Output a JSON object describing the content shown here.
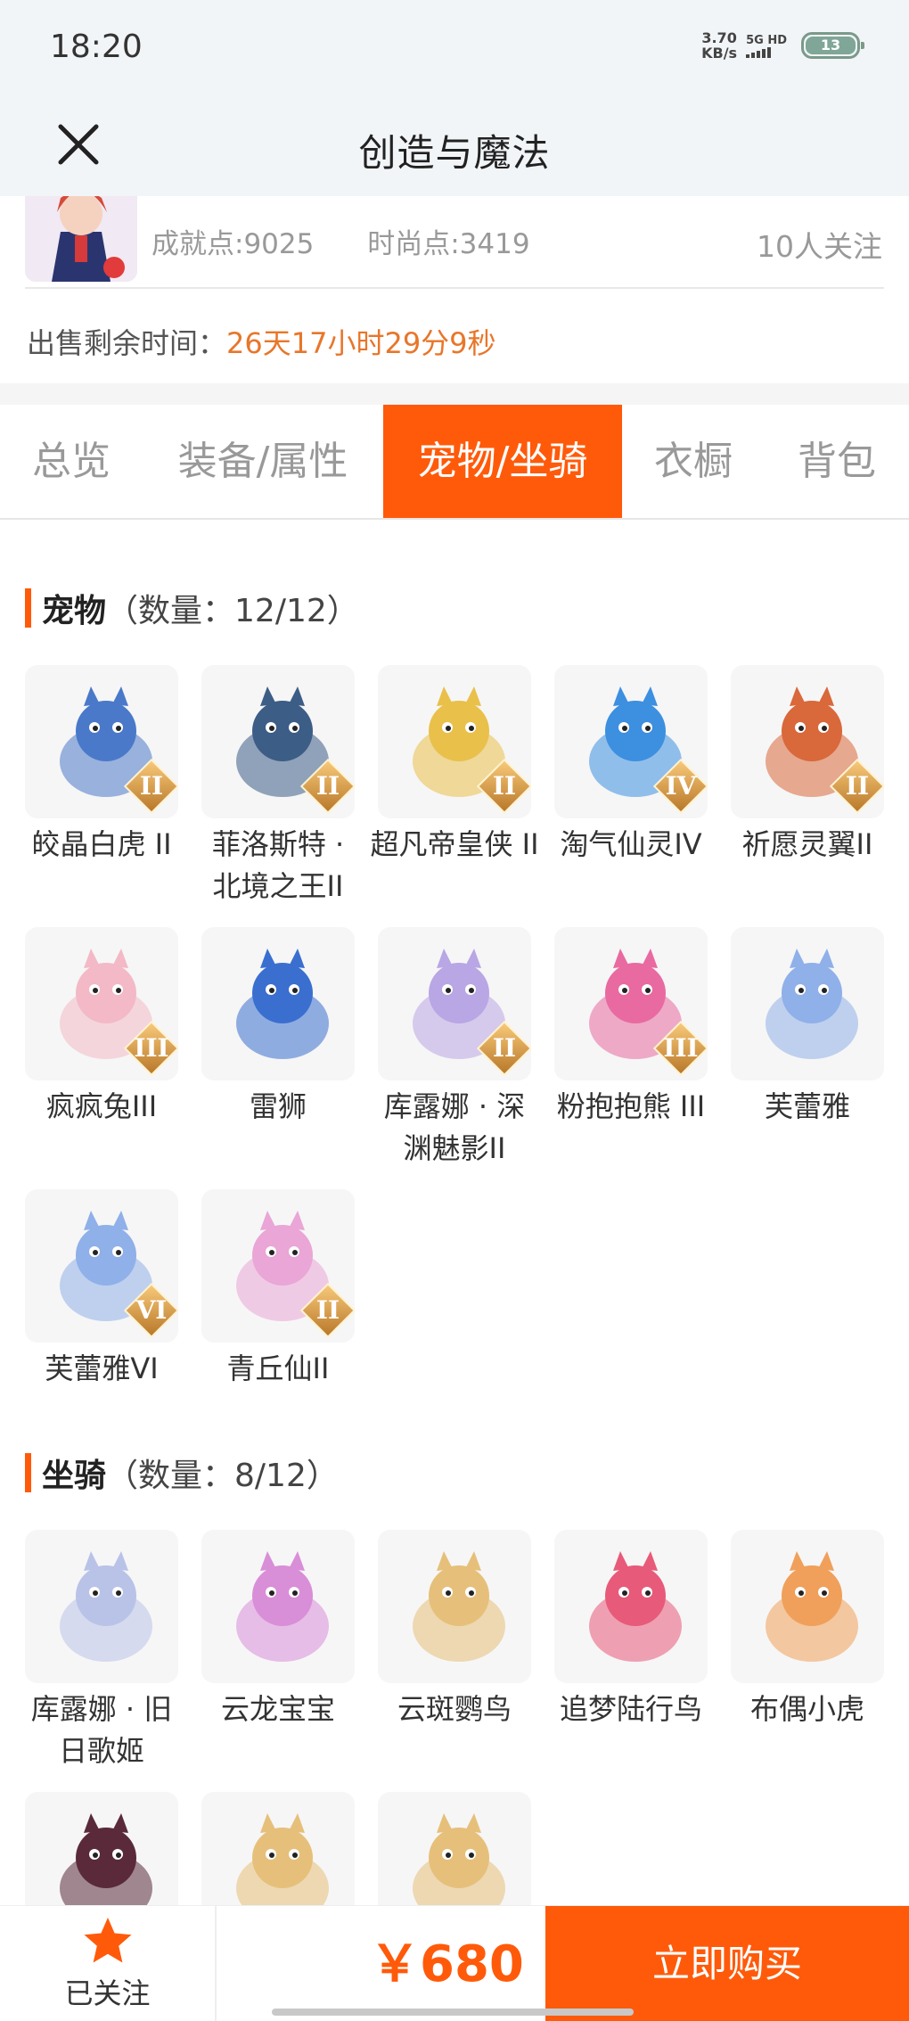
{
  "status_bar": {
    "time": "18:20",
    "net_speed_value": "3.70",
    "net_speed_unit": "KB/s",
    "network": "5G HD",
    "battery": "13"
  },
  "header": {
    "title": "创造与魔法"
  },
  "seller": {
    "achievement": "成就点:9025",
    "fashion": "时尚点:3419",
    "followers": "10人关注",
    "sale_time_label": "出售剩余时间：",
    "sale_time_value": "26天17小时29分9秒"
  },
  "tabs": [
    {
      "label": "总览"
    },
    {
      "label": "装备/属性"
    },
    {
      "label": "宠物/坐骑"
    },
    {
      "label": "衣橱"
    },
    {
      "label": "背包"
    }
  ],
  "active_tab": "宠物/坐骑",
  "pets": {
    "title": "宠物",
    "count": "（数量：12/12）",
    "items": [
      {
        "name": "皎晶白虎 II",
        "badge": "II",
        "color": "#4a79c9"
      },
      {
        "name": "菲洛斯特 · 北境之王II",
        "badge": "II",
        "color": "#3c5d86"
      },
      {
        "name": "超凡帝皇侠 II",
        "badge": "II",
        "color": "#e9c04a"
      },
      {
        "name": "淘气仙灵IV",
        "badge": "IV",
        "color": "#3d8fe0"
      },
      {
        "name": "祈愿灵翼II",
        "badge": "II",
        "color": "#d9683a"
      },
      {
        "name": "疯疯兔III",
        "badge": "III",
        "color": "#f3b9c6"
      },
      {
        "name": "雷狮",
        "badge": "",
        "color": "#3a6fd0"
      },
      {
        "name": "库露娜 · 深渊魅影II",
        "badge": "II",
        "color": "#b9a6e4"
      },
      {
        "name": "粉抱抱熊 III",
        "badge": "III",
        "color": "#e86aa0"
      },
      {
        "name": "芙蕾雅",
        "badge": "",
        "color": "#8fb0e8"
      },
      {
        "name": "芙蕾雅VI",
        "badge": "VI",
        "color": "#8fb0e8"
      },
      {
        "name": "青丘仙II",
        "badge": "II",
        "color": "#e9a6d6"
      }
    ]
  },
  "mounts": {
    "title": "坐骑",
    "count": "（数量：8/12）",
    "items": [
      {
        "name": "库露娜 · 旧日歌姬",
        "badge": "",
        "color": "#b9c3e8"
      },
      {
        "name": "云龙宝宝",
        "badge": "",
        "color": "#d98ed8"
      },
      {
        "name": "云斑鹦鸟",
        "badge": "",
        "color": "#e6c07a"
      },
      {
        "name": "追梦陆行鸟",
        "badge": "",
        "color": "#e85a7a"
      },
      {
        "name": "布偶小虎",
        "badge": "",
        "color": "#f0a05a"
      },
      {
        "name": "",
        "badge": "",
        "color": "#5a2a3a"
      },
      {
        "name": "",
        "badge": "",
        "color": "#e6c07a"
      },
      {
        "name": "",
        "badge": "",
        "color": "#e6c07a"
      }
    ]
  },
  "bottom_bar": {
    "follow_label": "已关注",
    "price": "￥680",
    "buy_label": "立即购买"
  }
}
